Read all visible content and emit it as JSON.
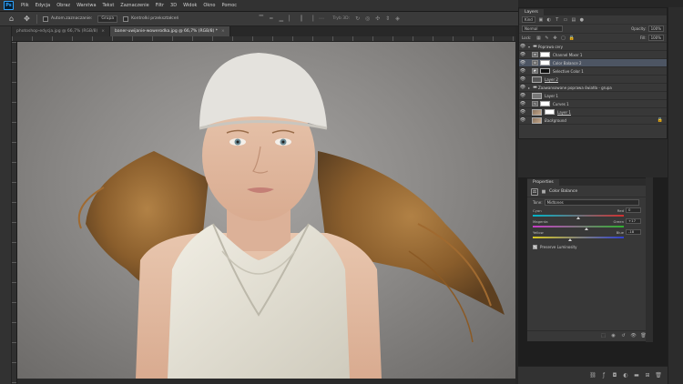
{
  "menubar": {
    "logo": "Ps",
    "items": [
      "Plik",
      "Edycja",
      "Obraz",
      "Warstwa",
      "Tekst",
      "Zaznaczenie",
      "Filtr",
      "3D",
      "Widok",
      "Okno",
      "Pomoc"
    ]
  },
  "options": {
    "auto_select_label": "Autom.zaznaczanie:",
    "group_select": "Grupa",
    "transform_label": "Kontrolki przekształceń",
    "mode_3d_label": "Tryb 3D:"
  },
  "tabs": [
    {
      "label": "photoshop-edycja.jpg @ 66,7% (RGB/8)",
      "active": false
    },
    {
      "label": "baner-uwijanie-wowerodka.jpg @ 66,7% (RGB/8) *",
      "active": true
    }
  ],
  "layers_panel": {
    "tab_label": "Layers",
    "kind_select": "Kind",
    "blend_mode": "Normal",
    "opacity_label": "Opacity:",
    "opacity_value": "100%",
    "lock_label": "Lock:",
    "fill_label": "Fill:",
    "fill_value": "100%",
    "layers": [
      {
        "name": "Poprawa cery",
        "type": "group",
        "selected": false,
        "indent": 0
      },
      {
        "name": "Channel Mixer 1",
        "type": "adjustment",
        "selected": false,
        "indent": 1
      },
      {
        "name": "Color Balance 2",
        "type": "adjustment",
        "selected": true,
        "indent": 1
      },
      {
        "name": "Selective Color 1",
        "type": "adjustment",
        "selected": false,
        "indent": 1
      },
      {
        "name": "Layer 2",
        "type": "pixel",
        "selected": false,
        "indent": 0
      },
      {
        "name": "Zaawansowane poprawa światła - grupa",
        "type": "group",
        "selected": false,
        "indent": 0
      },
      {
        "name": "Layer 1",
        "type": "pixel",
        "selected": false,
        "indent": 0
      },
      {
        "name": "Curves 1",
        "type": "adjustment",
        "selected": false,
        "indent": 0
      },
      {
        "name": "Layer 1",
        "type": "pixel",
        "selected": false,
        "indent": 0
      },
      {
        "name": "Background",
        "type": "background",
        "selected": false,
        "indent": 0
      }
    ]
  },
  "properties_panel": {
    "tab_label": "Properties",
    "title": "Color Balance",
    "tone_label": "Tone:",
    "tone_value": "Midtones",
    "sliders": [
      {
        "left": "Cyan",
        "right": "Red",
        "value": "0",
        "position": 0.5,
        "from": "#00b4c8",
        "to": "#d03030"
      },
      {
        "left": "Magenta",
        "right": "Green",
        "value": "+17",
        "position": 0.585,
        "from": "#c83cc8",
        "to": "#30b030"
      },
      {
        "left": "Yellow",
        "right": "Blue",
        "value": "-18",
        "position": 0.41,
        "from": "#d8c820",
        "to": "#3040d0"
      }
    ],
    "preserve_luminosity": "Preserve Luminosity",
    "preserve_checked": true
  },
  "colors": {
    "accent": "#2fa3ff",
    "selection": "#4d5563",
    "panel_bg": "#383838"
  }
}
